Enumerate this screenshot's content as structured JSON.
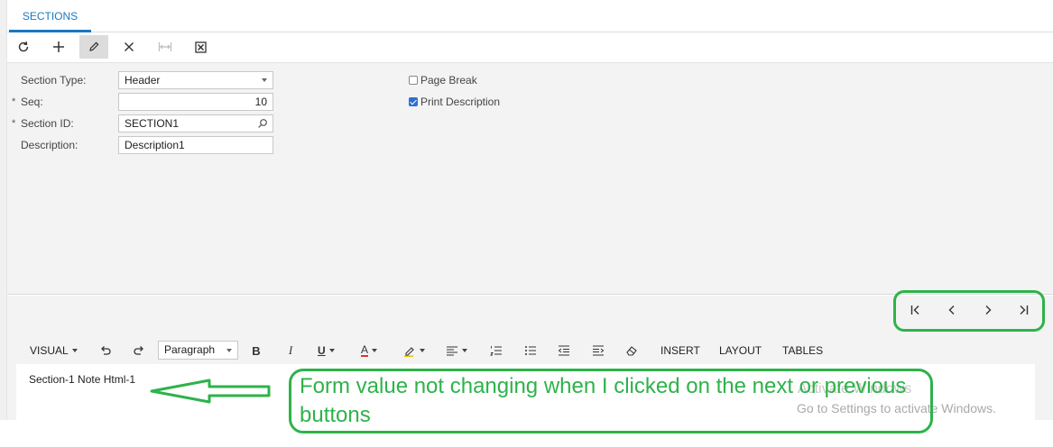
{
  "tab": {
    "label": "SECTIONS"
  },
  "toolbar": {
    "refresh_icon": "refresh-icon",
    "add_icon": "plus-icon",
    "edit_icon": "pencil-icon",
    "delete_icon": "close-icon",
    "fit_icon": "fit-width-icon",
    "export_icon": "excel-icon"
  },
  "form": {
    "section_type": {
      "label": "Section Type:",
      "value": "Header"
    },
    "seq": {
      "required": "*",
      "label": "Seq:",
      "value": "10"
    },
    "section_id": {
      "required": "*",
      "label": "Section ID:",
      "value": "SECTION1"
    },
    "description": {
      "label": "Description:",
      "value": "Description1"
    },
    "page_break": {
      "label": "Page Break",
      "checked": false
    },
    "print_description": {
      "label": "Print Description",
      "checked": true
    }
  },
  "pager": {
    "first_icon": "first-page-icon",
    "prev_icon": "chevron-left-icon",
    "next_icon": "chevron-right-icon",
    "last_icon": "last-page-icon"
  },
  "editor": {
    "mode": "VISUAL",
    "paragraph": "Paragraph",
    "bold": "B",
    "italic": "I",
    "underline": "U",
    "font_color": "A",
    "insert": "INSERT",
    "layout": "LAYOUT",
    "tables": "TABLES",
    "content": "Section-1 Note Html-1"
  },
  "annotation": {
    "text": "Form value not changing when I clicked on the next or previous buttons",
    "color": "#2db34a"
  },
  "watermark": {
    "line1": "Activate Windows",
    "line2": "Go to Settings to activate Windows."
  },
  "colors": {
    "accent": "#1a78c2",
    "annotation_green": "#2db34a"
  }
}
